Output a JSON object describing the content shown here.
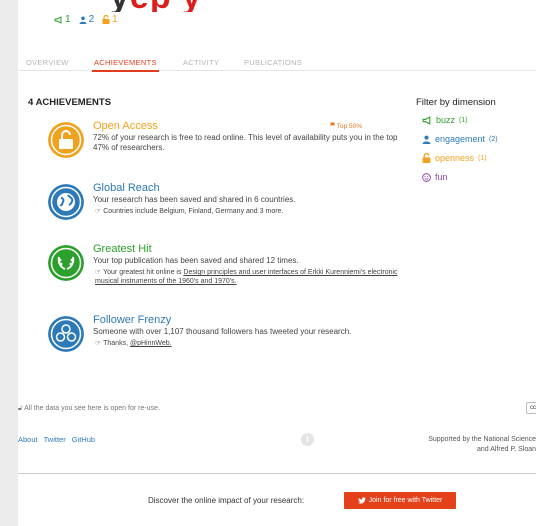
{
  "header": {
    "name_dark": "y",
    "name_red": "ep    y",
    "counts": [
      {
        "icon": "megaphone-icon",
        "value": "1"
      },
      {
        "icon": "person-icon",
        "value": "2"
      },
      {
        "icon": "unlock-icon",
        "value": "1"
      }
    ]
  },
  "tabs": [
    {
      "label": "OVERVIEW"
    },
    {
      "label": "ACHIEVEMENTS",
      "active": true
    },
    {
      "label": "ACTIVITY"
    },
    {
      "label": "PUBLICATIONS"
    }
  ],
  "achievements_heading": "4 ACHIEVEMENTS",
  "achievements": [
    {
      "title": "Open Access",
      "title_color": "#f0a21e",
      "top_label": "Top 50%",
      "description": "72% of your research is free to read online. This level of availability puts you in the top 47% of researchers.",
      "note_prefix": "",
      "note_link": ""
    },
    {
      "title": "Global Reach",
      "title_color": "#2e7ab8",
      "description": "Your research has been saved and shared in 6 countries.",
      "note_prefix": "Countries include Belgium, Finland, Germany and 3 more.",
      "note_link": ""
    },
    {
      "title": "Greatest Hit",
      "title_color": "#2ca02c",
      "description": "Your top publication has been saved and shared 12 times.",
      "note_prefix": "Your greatest hit online is ",
      "note_link": "Design principles and user interfaces of Erkki Kurenniemi's electronic musical instruments of the 1960's and 1970's."
    },
    {
      "title": "Follower Frenzy",
      "title_color": "#2e7ab8",
      "description": "Someone with over 1,107 thousand followers has tweeted your research.",
      "note_prefix": "Thanks, ",
      "note_link": "@pHinnWeb."
    }
  ],
  "filter": {
    "heading": "Filter by dimension",
    "items": [
      {
        "label": "buzz",
        "count": "(1)",
        "icon": "megaphone-icon",
        "color": "#2ca02c"
      },
      {
        "label": "engagement",
        "count": "(2)",
        "icon": "person-icon",
        "color": "#2e7ab8"
      },
      {
        "label": "openness",
        "count": "(1)",
        "icon": "unlock-icon",
        "color": "#f0a21e"
      },
      {
        "label": "fun",
        "count": "",
        "icon": "smiley-icon",
        "color": "#8e3fa8"
      }
    ]
  },
  "footer": {
    "open_note": "All the data you see here is open for re-use.",
    "cc_label": "cc",
    "links": [
      "About",
      "Twitter",
      "GitHub"
    ],
    "info_label": "i",
    "support_line1": "Supported by the National Science",
    "support_line2": "and Alfred P. Sloan"
  },
  "cta": {
    "text": "Discover the online impact of your research:",
    "button": "Join for free with Twitter"
  }
}
